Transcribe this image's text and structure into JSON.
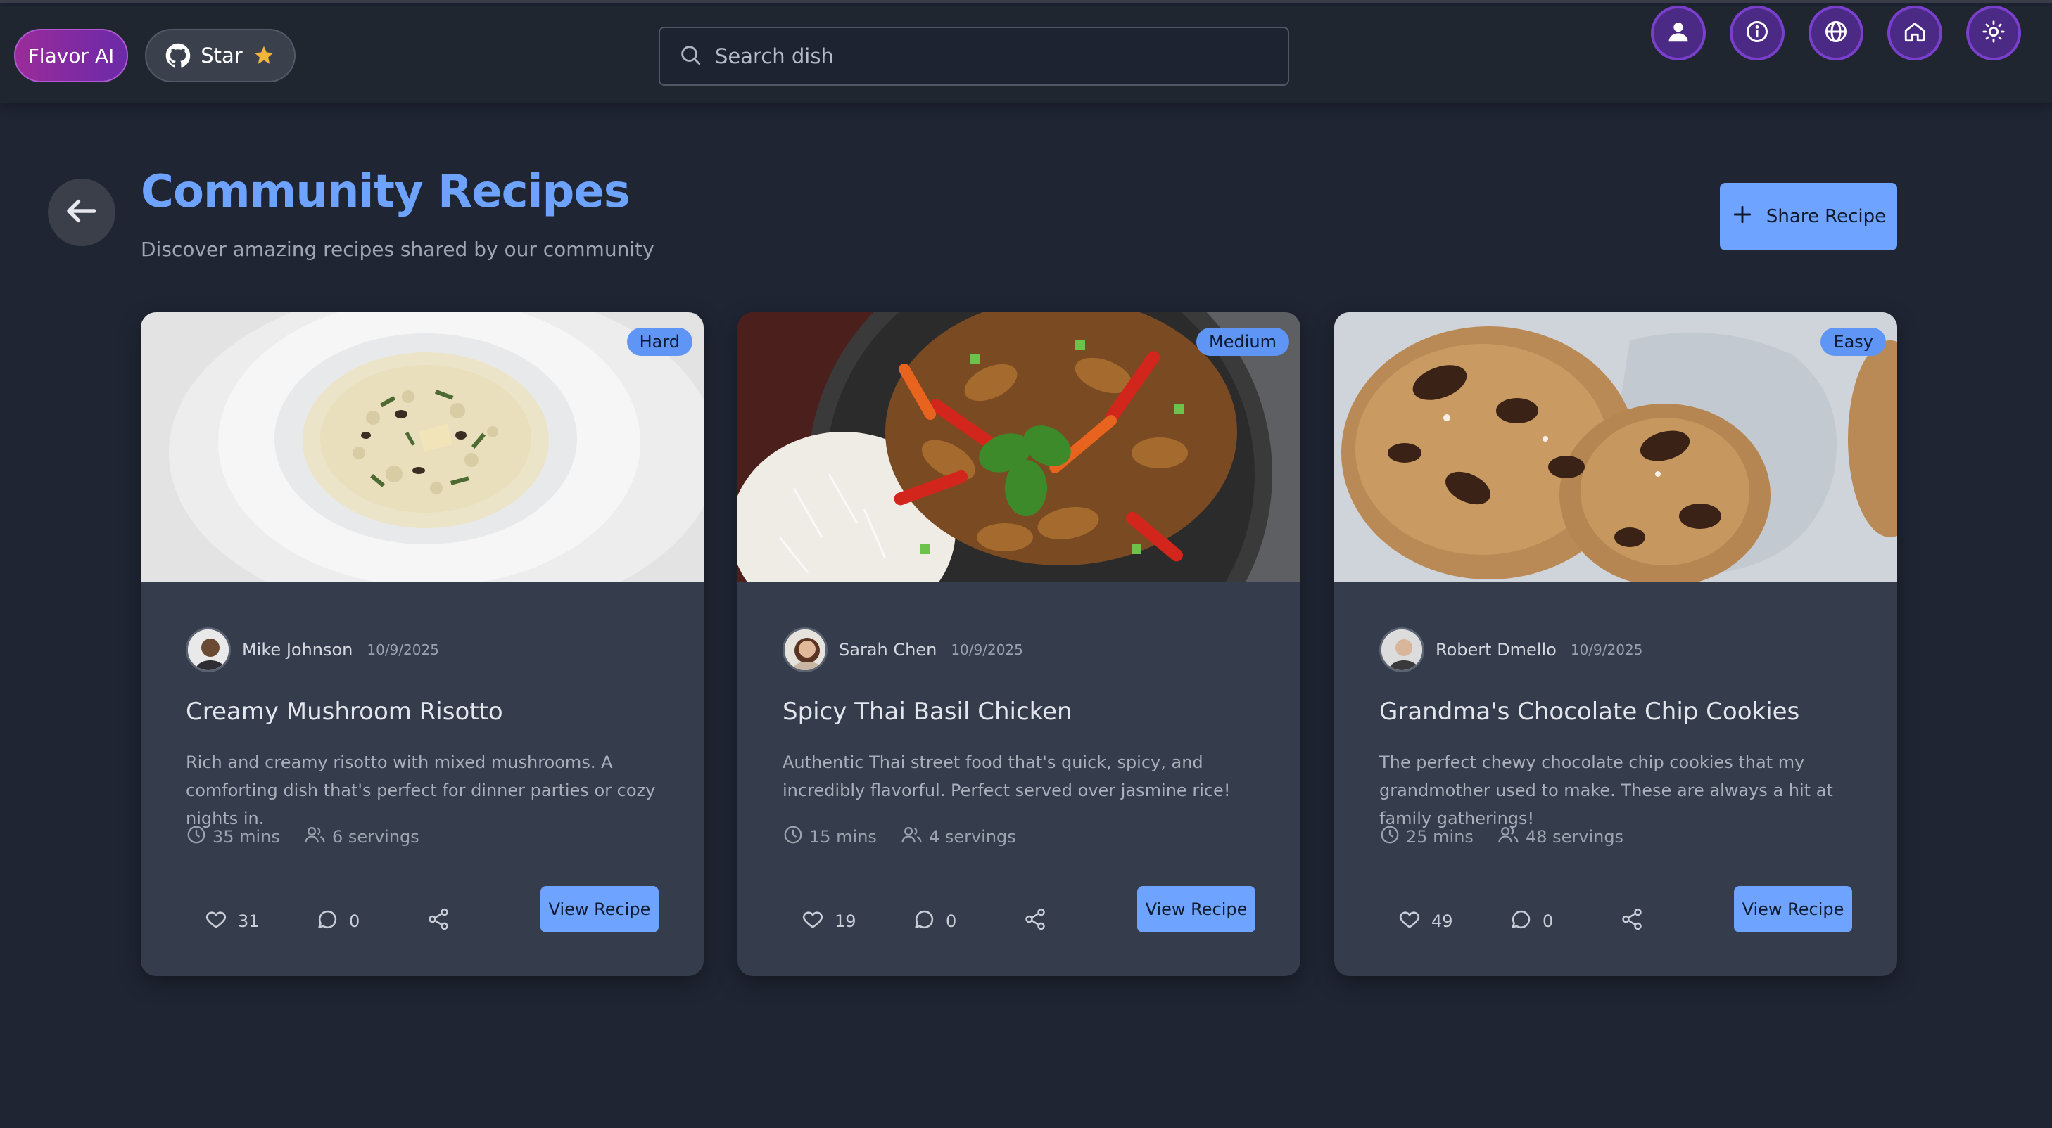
{
  "header": {
    "brand": "Flavor AI",
    "star_label": "Star",
    "search": {
      "placeholder": "Search dish",
      "value": ""
    },
    "icons": [
      "user-icon",
      "info-icon",
      "globe-icon",
      "home-icon",
      "sun-icon"
    ],
    "accent_colors": {
      "brand_gradient_start": "#9b2b9a",
      "brand_gradient_end": "#6a2aa8",
      "icon_button": "#4b2a86",
      "star": "#f2b43a"
    }
  },
  "page": {
    "title": "Community Recipes",
    "subtitle": "Discover amazing recipes shared by our community",
    "share_button": "Share Recipe",
    "colors": {
      "title": "#6da2ff",
      "primary_button": "#6ea3ff",
      "card_bg": "#353c4b",
      "page_bg": "#1f2533"
    }
  },
  "recipes": [
    {
      "difficulty": "Hard",
      "author": "Mike Johnson",
      "date": "10/9/2025",
      "title": "Creamy Mushroom Risotto",
      "description": "Rich and creamy risotto with mixed mushrooms. A comforting dish that's perfect for dinner parties or cozy nights in.",
      "time": "35 mins",
      "servings": "6 servings",
      "likes": "31",
      "comments": "0",
      "view_label": "View Recipe"
    },
    {
      "difficulty": "Medium",
      "author": "Sarah Chen",
      "date": "10/9/2025",
      "title": "Spicy Thai Basil Chicken",
      "description": "Authentic Thai street food that's quick, spicy, and incredibly flavorful. Perfect served over jasmine rice!",
      "time": "15 mins",
      "servings": "4 servings",
      "likes": "19",
      "comments": "0",
      "view_label": "View Recipe"
    },
    {
      "difficulty": "Easy",
      "author": "Robert Dmello",
      "date": "10/9/2025",
      "title": "Grandma's Chocolate Chip Cookies",
      "description": "The perfect chewy chocolate chip cookies that my grandmother used to make. These are always a hit at family gatherings!",
      "time": "25 mins",
      "servings": "48 servings",
      "likes": "49",
      "comments": "0",
      "view_label": "View Recipe"
    }
  ]
}
